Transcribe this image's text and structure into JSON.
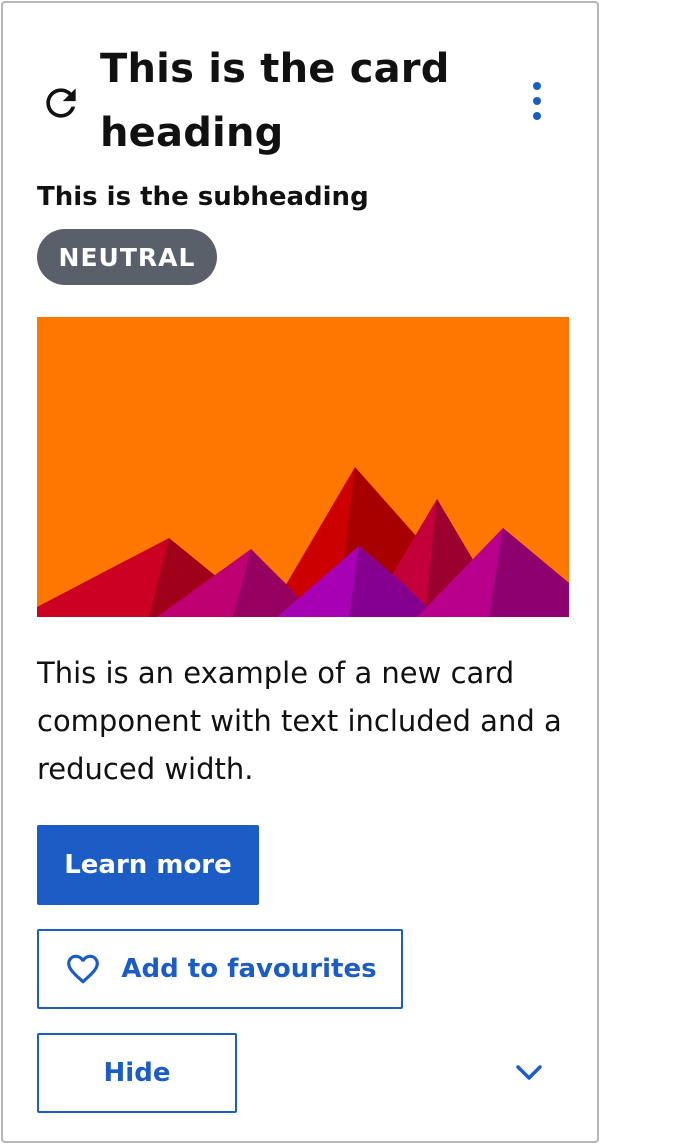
{
  "card": {
    "heading": "This is the card heading",
    "subheading": "This is the subheading",
    "badge": "NEUTRAL",
    "body": "This is an example of a new card component with text included and a reduced width.",
    "buttons": {
      "learn_more": "Learn more",
      "add_to_favourites": "Add to favourites",
      "hide": "Hide"
    }
  },
  "icons": {
    "refresh": "refresh-icon",
    "menu": "more-vertical-icon",
    "heart": "heart-icon",
    "expand": "chevron-down-icon"
  },
  "colors": {
    "accent": "#1b5cc5",
    "badge_background": "#5a6069",
    "image_background": "#ff7700",
    "card_border": "#b4b6b9"
  }
}
